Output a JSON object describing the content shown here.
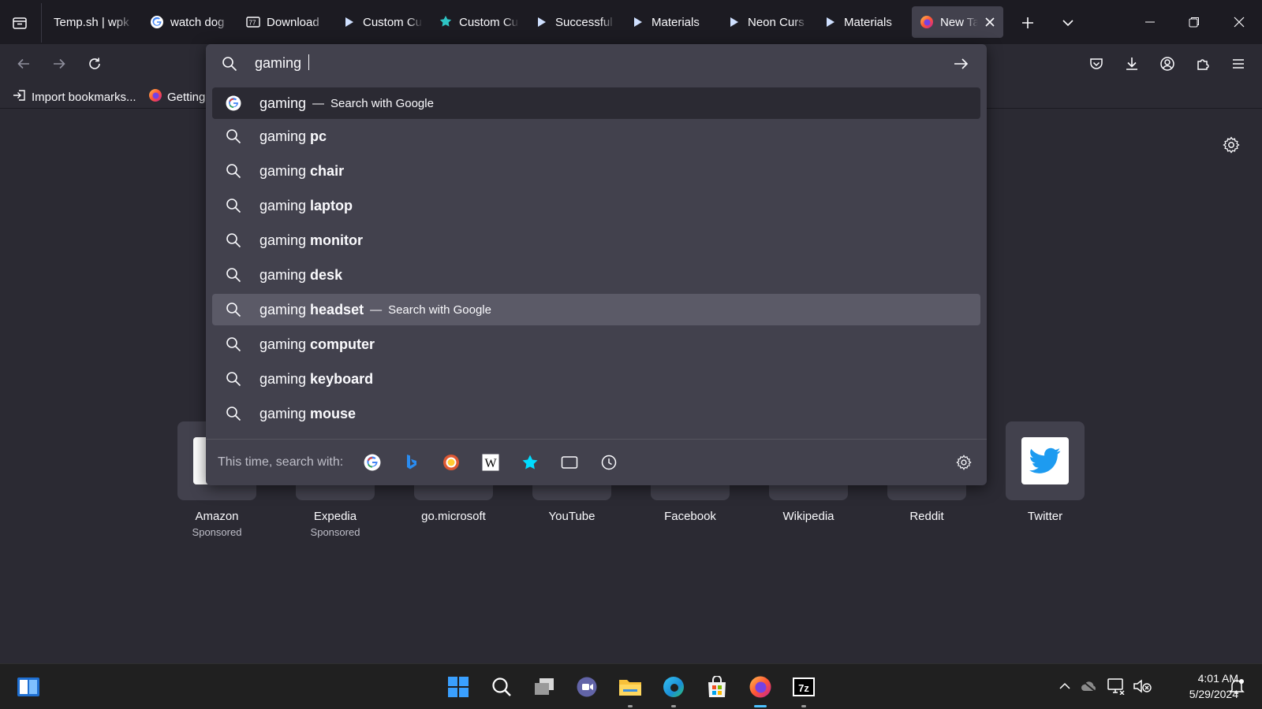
{
  "tabs": [
    {
      "label": "Temp.sh | wpk",
      "icon": "tempsh-icon"
    },
    {
      "label": "watch dog",
      "icon": "google-icon"
    },
    {
      "label": "Download",
      "icon": "download-page-icon"
    },
    {
      "label": "Custom Cu",
      "icon": "play-icon"
    },
    {
      "label": "Custom Cu",
      "icon": "puzzle-star-icon"
    },
    {
      "label": "Successful",
      "icon": "play-icon"
    },
    {
      "label": "Materials",
      "icon": "play-icon"
    },
    {
      "label": "Neon Curs",
      "icon": "play-icon"
    },
    {
      "label": "Materials",
      "icon": "play-icon"
    },
    {
      "label": "New Tab",
      "icon": "firefox-icon",
      "active": true
    }
  ],
  "bookmarks": {
    "import": "Import bookmarks...",
    "getting_started": "Getting"
  },
  "urlbar": {
    "value": "gaming "
  },
  "suggestions": {
    "first": {
      "prefix": "gaming",
      "action": "Search with Google"
    },
    "items": [
      {
        "prefix": "gaming",
        "bold": "pc"
      },
      {
        "prefix": "gaming",
        "bold": "chair"
      },
      {
        "prefix": "gaming",
        "bold": "laptop"
      },
      {
        "prefix": "gaming",
        "bold": "monitor"
      },
      {
        "prefix": "gaming",
        "bold": "desk"
      }
    ],
    "hovered": {
      "prefix": "gaming",
      "bold": "headset",
      "action": "Search with Google"
    },
    "rest": [
      {
        "prefix": "gaming",
        "bold": "computer"
      },
      {
        "prefix": "gaming",
        "bold": "keyboard"
      },
      {
        "prefix": "gaming",
        "bold": "mouse"
      }
    ]
  },
  "oneoff": {
    "label": "This time, search with:",
    "engines": [
      "google-icon",
      "bing-icon",
      "duckduckgo-icon",
      "wikipedia-icon",
      "bookmarks-star-icon",
      "tabs-icon",
      "history-icon"
    ]
  },
  "top_sites": [
    {
      "name": "Amazon",
      "sub": "Sponsored"
    },
    {
      "name": "Expedia",
      "sub": "Sponsored"
    },
    {
      "name": "go.microsoft",
      "sub": ""
    },
    {
      "name": "YouTube",
      "sub": ""
    },
    {
      "name": "Facebook",
      "sub": ""
    },
    {
      "name": "Wikipedia",
      "sub": ""
    },
    {
      "name": "Reddit",
      "sub": ""
    },
    {
      "name": "Twitter",
      "sub": ""
    }
  ],
  "taskbar": {
    "time": "4:01 AM",
    "date": "5/29/2024"
  },
  "colors": {
    "toolbar": "#1c1b22",
    "content": "#2b2a33",
    "popup": "#42414d",
    "twitter": "#1d9bf0",
    "accent": "#4cc2ff"
  }
}
